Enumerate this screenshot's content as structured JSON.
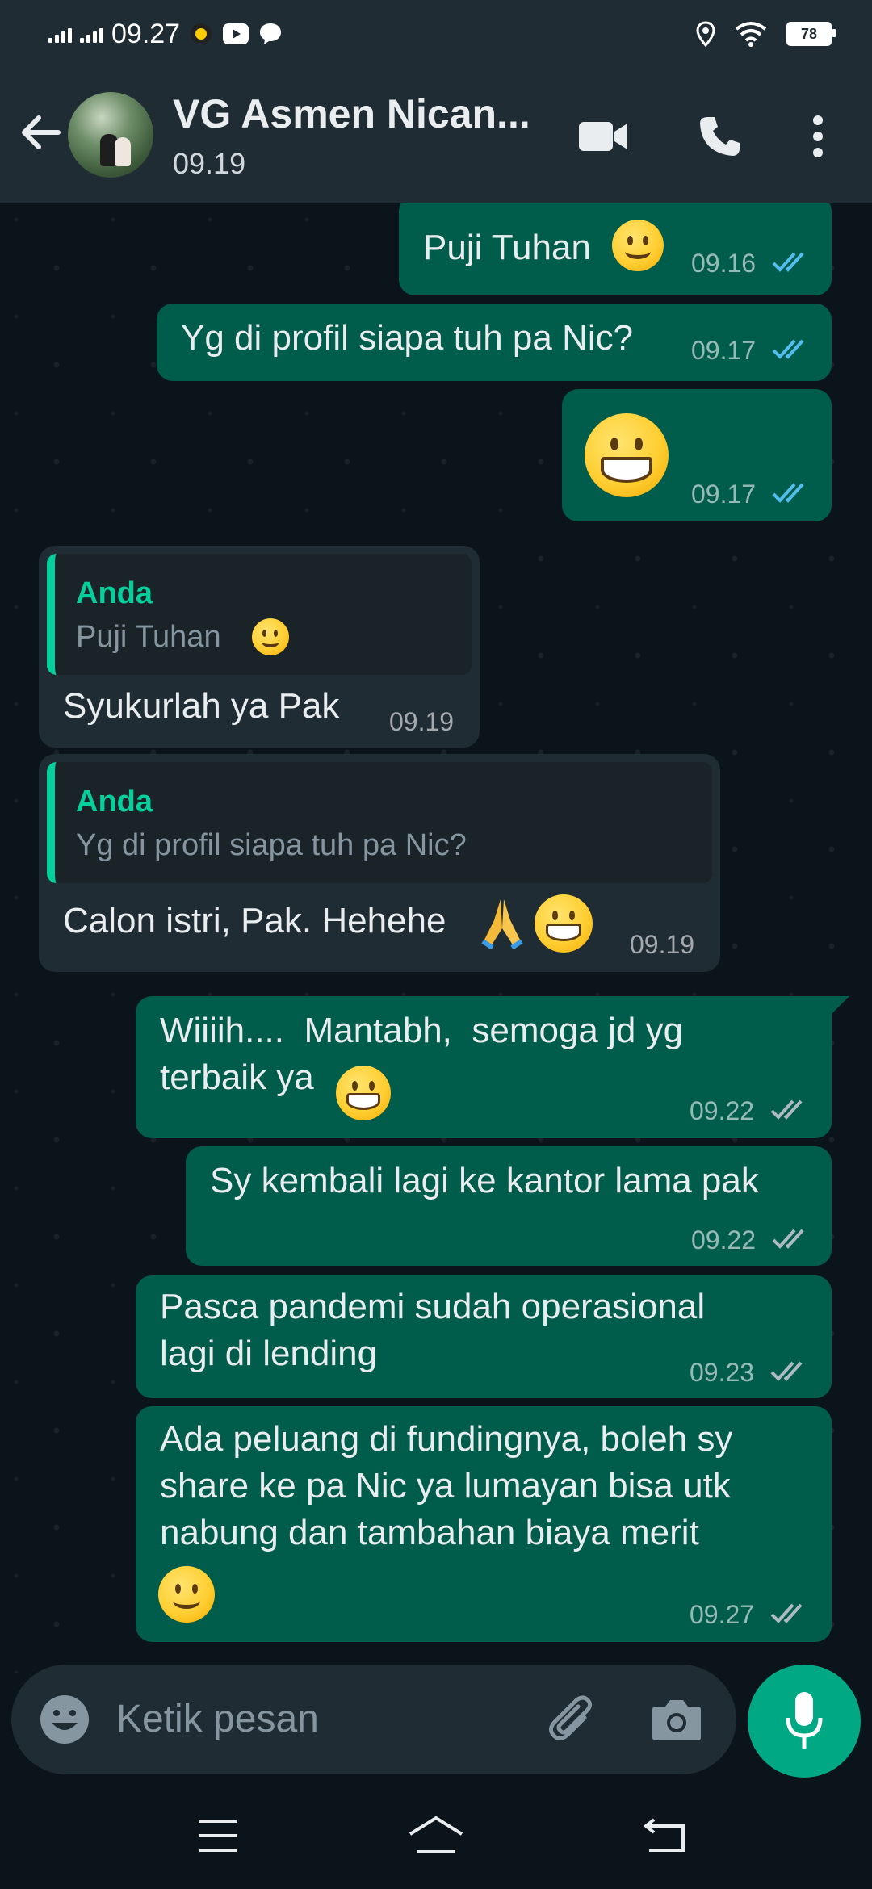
{
  "status_bar": {
    "time": "09.27",
    "battery": "78"
  },
  "header": {
    "contact_name": "VG Asmen Nican...",
    "last_seen": "09.19"
  },
  "messages": [
    {
      "direction": "out",
      "text": "Puji Tuhan",
      "emoji": "slightly-smiling-face",
      "time": "09.16",
      "status": "read"
    },
    {
      "direction": "out",
      "text": "Yg di profil siapa tuh pa Nic?",
      "time": "09.17",
      "status": "read"
    },
    {
      "direction": "out",
      "text": "",
      "emoji": "grinning-face",
      "time": "09.17",
      "status": "read"
    },
    {
      "direction": "in",
      "quote_author": "Anda",
      "quote_text": "Puji Tuhan",
      "quote_emoji": "slightly-smiling-face",
      "text": "Syukurlah ya Pak",
      "time": "09.19"
    },
    {
      "direction": "in",
      "quote_author": "Anda",
      "quote_text": "Yg di profil siapa tuh pa Nic?",
      "text": "Calon istri, Pak. Hehehe",
      "emoji": "folded-hands grinning-face",
      "time": "09.19"
    },
    {
      "direction": "out",
      "text": "Wiiiih....  Mantabh,  semoga jd yg\nterbaik ya",
      "emoji": "grinning-face",
      "time": "09.22",
      "status": "delivered"
    },
    {
      "direction": "out",
      "text": "Sy kembali lagi ke kantor lama pak",
      "time": "09.22",
      "status": "delivered"
    },
    {
      "direction": "out",
      "text": "Pasca pandemi sudah operasional\nlagi di lending",
      "time": "09.23",
      "status": "delivered"
    },
    {
      "direction": "out",
      "text": "Ada peluang di fundingnya, boleh sy\nshare ke pa Nic ya lumayan bisa utk\nnabung dan tambahan biaya merit",
      "emoji": "slightly-smiling-face",
      "time": "09.27",
      "status": "delivered"
    }
  ],
  "composer": {
    "placeholder": "Ketik pesan"
  },
  "colors": {
    "outgoing_bubble": "#005c4b",
    "incoming_bubble": "#202c33",
    "accent": "#00a884",
    "read_tick": "#53bdeb",
    "quote_author": "#06cf9c"
  }
}
